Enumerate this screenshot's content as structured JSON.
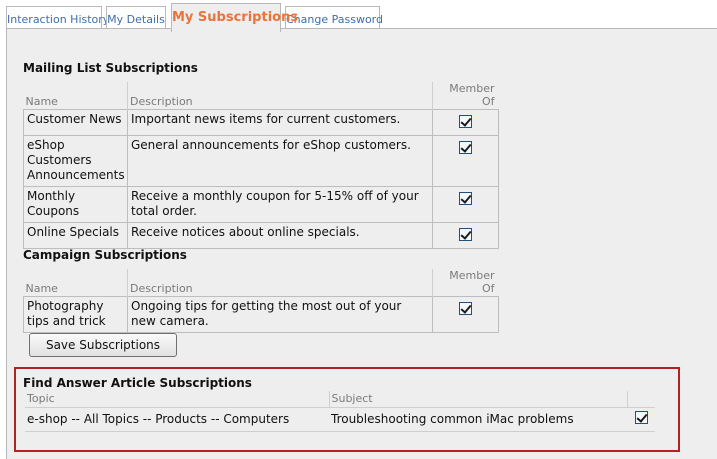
{
  "tabs": [
    {
      "label": "Interaction History",
      "active": false
    },
    {
      "label": "My Details",
      "active": false
    },
    {
      "label": "My Subscriptions",
      "active": true
    },
    {
      "label": "Change Password",
      "active": false
    }
  ],
  "mailing": {
    "title": "Mailing List Subscriptions",
    "headers": {
      "name": "Name",
      "description": "Description",
      "member_of": "Member Of"
    },
    "rows": [
      {
        "name": "Customer News",
        "description": "Important news items for current customers.",
        "checked": true
      },
      {
        "name": "eShop Customers Announcements",
        "description": "General announcements for eShop customers.",
        "checked": true
      },
      {
        "name": "Monthly Coupons",
        "description": "Receive a monthly coupon for 5-15% off of your total order.",
        "checked": true
      },
      {
        "name": "Online Specials",
        "description": "Receive notices about online specials.",
        "checked": true
      }
    ]
  },
  "campaign": {
    "title": "Campaign Subscriptions",
    "headers": {
      "name": "Name",
      "description": "Description",
      "member_of": "Member Of"
    },
    "rows": [
      {
        "name": "Photography tips and trick",
        "description": "Ongoing tips for getting the most out of your new camera.",
        "checked": true
      }
    ]
  },
  "save_button": "Save Subscriptions",
  "find_answer": {
    "title": "Find Answer Article Subscriptions",
    "headers": {
      "topic": "Topic",
      "subject": "Subject"
    },
    "rows": [
      {
        "topic": "e-shop -- All Topics -- Products -- Computers",
        "subject": "Troubleshooting common iMac problems",
        "checked": true
      }
    ]
  },
  "colors": {
    "active_tab": "#e8743b",
    "tab_link": "#3e6ea8",
    "highlight_border": "#b22222"
  }
}
